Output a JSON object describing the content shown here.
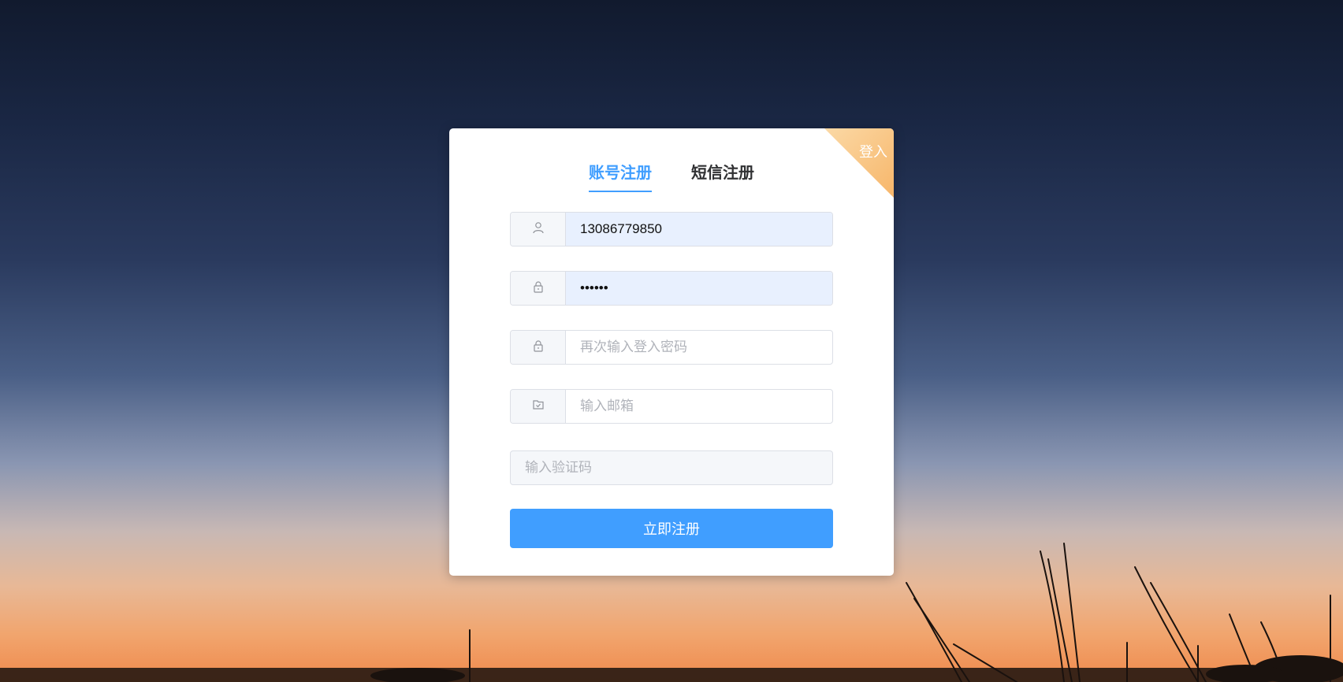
{
  "tabs": [
    {
      "label": "账号注册",
      "active": true
    },
    {
      "label": "短信注册",
      "active": false
    }
  ],
  "corner_link": "登入",
  "form": {
    "username": {
      "value": "13086779850",
      "icon": "user-icon"
    },
    "password": {
      "value": "••••••",
      "icon": "lock-icon"
    },
    "confirm_password": {
      "value": "",
      "placeholder": "再次输入登入密码",
      "icon": "lock-icon"
    },
    "email": {
      "value": "",
      "placeholder": "输入邮箱",
      "icon": "mail-icon"
    },
    "captcha": {
      "value": "",
      "placeholder": "输入验证码"
    }
  },
  "submit_label": "立即注册",
  "colors": {
    "accent": "#409eff",
    "corner": "#f9c27a",
    "autofill": "#e8f0fe"
  }
}
